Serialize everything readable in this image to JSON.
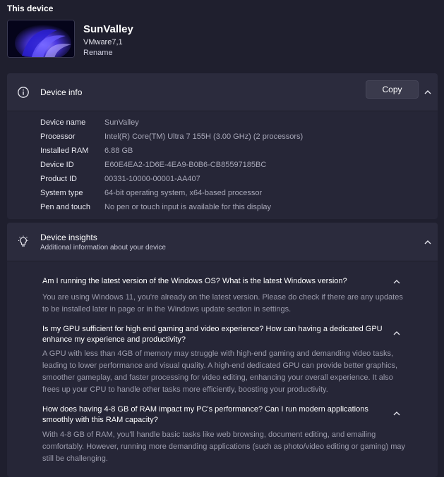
{
  "page": {
    "section_title": "This device"
  },
  "device": {
    "name": "SunValley",
    "model": "VMware7,1",
    "rename_label": "Rename"
  },
  "device_info": {
    "title": "Device info",
    "copy_label": "Copy",
    "rows": [
      {
        "label": "Device name",
        "value": "SunValley"
      },
      {
        "label": "Processor",
        "value": "Intel(R) Core(TM) Ultra 7 155H (3.00 GHz) (2 processors)"
      },
      {
        "label": "Installed RAM",
        "value": "6.88 GB"
      },
      {
        "label": "Device ID",
        "value": "E60E4EA2-1D6E-4EA9-B0B6-CB85597185BC"
      },
      {
        "label": "Product ID",
        "value": "00331-10000-00001-AA407"
      },
      {
        "label": "System type",
        "value": "64-bit operating system, x64-based processor"
      },
      {
        "label": "Pen and touch",
        "value": "No pen or touch input is available for this display"
      }
    ]
  },
  "device_insights": {
    "title": "Device insights",
    "subtitle": "Additional information about your device",
    "faqs": [
      {
        "question": "Am I running the latest version of the Windows OS? What is the latest Windows version?",
        "answer": "You are using Windows 11, you're already on the latest version. Please do check if there are any updates to be installed later in page or in the Windows update section in settings."
      },
      {
        "question": "Is my GPU sufficient for high end gaming and video experience? How can having a dedicated GPU enhance my experience and productivity?",
        "answer": "A GPU with less than 4GB of memory may struggle with high-end gaming and demanding video tasks, leading to lower performance and visual quality. A high-end dedicated GPU can provide better graphics, smoother gameplay, and faster processing for video editing, enhancing your overall experience. It also frees up your CPU to handle other tasks more efficiently, boosting your productivity."
      },
      {
        "question": "How does having 4-8 GB of RAM impact my PC's performance? Can I run modern applications smoothly with this RAM capacity?",
        "answer": "With 4-8 GB of RAM, you'll handle basic tasks like web browsing, document editing, and emailing comfortably. However, running more demanding applications (such as photo/video editing or gaming) may still be challenging."
      }
    ]
  },
  "colors": {
    "background": "#1f1f2e",
    "card": "#262637",
    "card_header": "#2b2b3d",
    "accent_bloom": "#5b4cff"
  }
}
